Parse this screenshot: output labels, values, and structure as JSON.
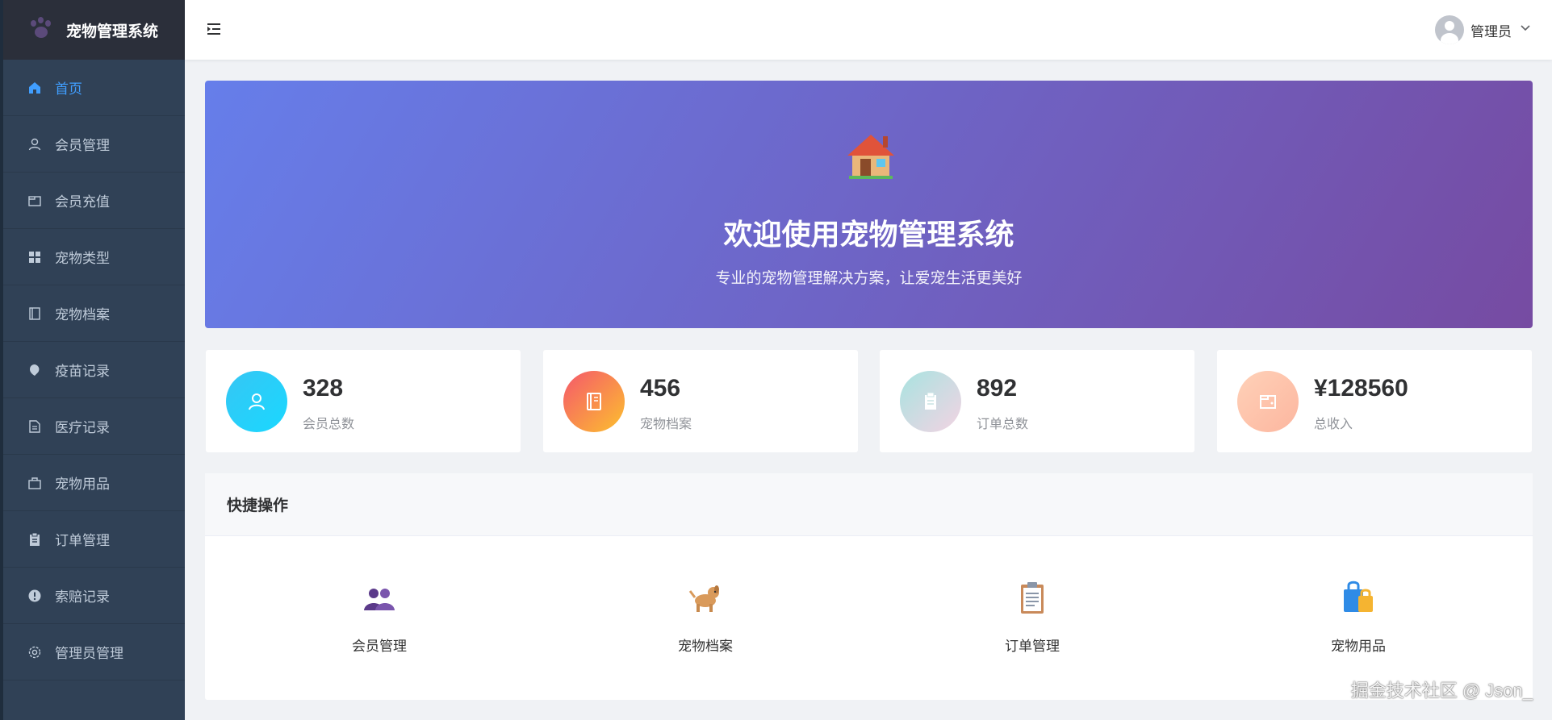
{
  "app": {
    "title": "宠物管理系统"
  },
  "sidebar": {
    "items": [
      {
        "label": "首页",
        "icon": "home-icon",
        "active": true
      },
      {
        "label": "会员管理",
        "icon": "user-icon"
      },
      {
        "label": "会员充值",
        "icon": "wallet-icon"
      },
      {
        "label": "宠物类型",
        "icon": "grid-icon"
      },
      {
        "label": "宠物档案",
        "icon": "notebook-icon"
      },
      {
        "label": "疫苗记录",
        "icon": "drop-icon"
      },
      {
        "label": "医疗记录",
        "icon": "document-icon"
      },
      {
        "label": "宠物用品",
        "icon": "bag-icon"
      },
      {
        "label": "订单管理",
        "icon": "clipboard-icon"
      },
      {
        "label": "索赔记录",
        "icon": "warning-icon"
      },
      {
        "label": "管理员管理",
        "icon": "gear-icon"
      }
    ]
  },
  "header": {
    "user_name": "管理员"
  },
  "banner": {
    "icon": "house-icon",
    "title": "欢迎使用宠物管理系统",
    "subtitle": "专业的宠物管理解决方案，让爱宠生活更美好"
  },
  "stats": [
    {
      "value": "328",
      "label": "会员总数",
      "icon": "user-icon",
      "colors": [
        "#36c6f4",
        "#1ad8ff"
      ]
    },
    {
      "value": "456",
      "label": "宠物档案",
      "icon": "notebook-icon",
      "colors": [
        "#f5576c",
        "#fcc02e"
      ]
    },
    {
      "value": "892",
      "label": "订单总数",
      "icon": "clipboard-icon",
      "colors": [
        "#a8e3e0",
        "#f3d3e3"
      ]
    },
    {
      "value": "¥128560",
      "label": "总收入",
      "icon": "wallet-icon",
      "colors": [
        "#ffd1b8",
        "#fcb69f"
      ]
    }
  ],
  "quick": {
    "title": "快捷操作",
    "actions": [
      {
        "label": "会员管理",
        "icon": "users-icon"
      },
      {
        "label": "宠物档案",
        "icon": "dog-icon"
      },
      {
        "label": "订单管理",
        "icon": "clipboard-icon"
      },
      {
        "label": "宠物用品",
        "icon": "shopping-bags-icon"
      }
    ]
  },
  "watermark": "掘金技术社区 @ Json_"
}
